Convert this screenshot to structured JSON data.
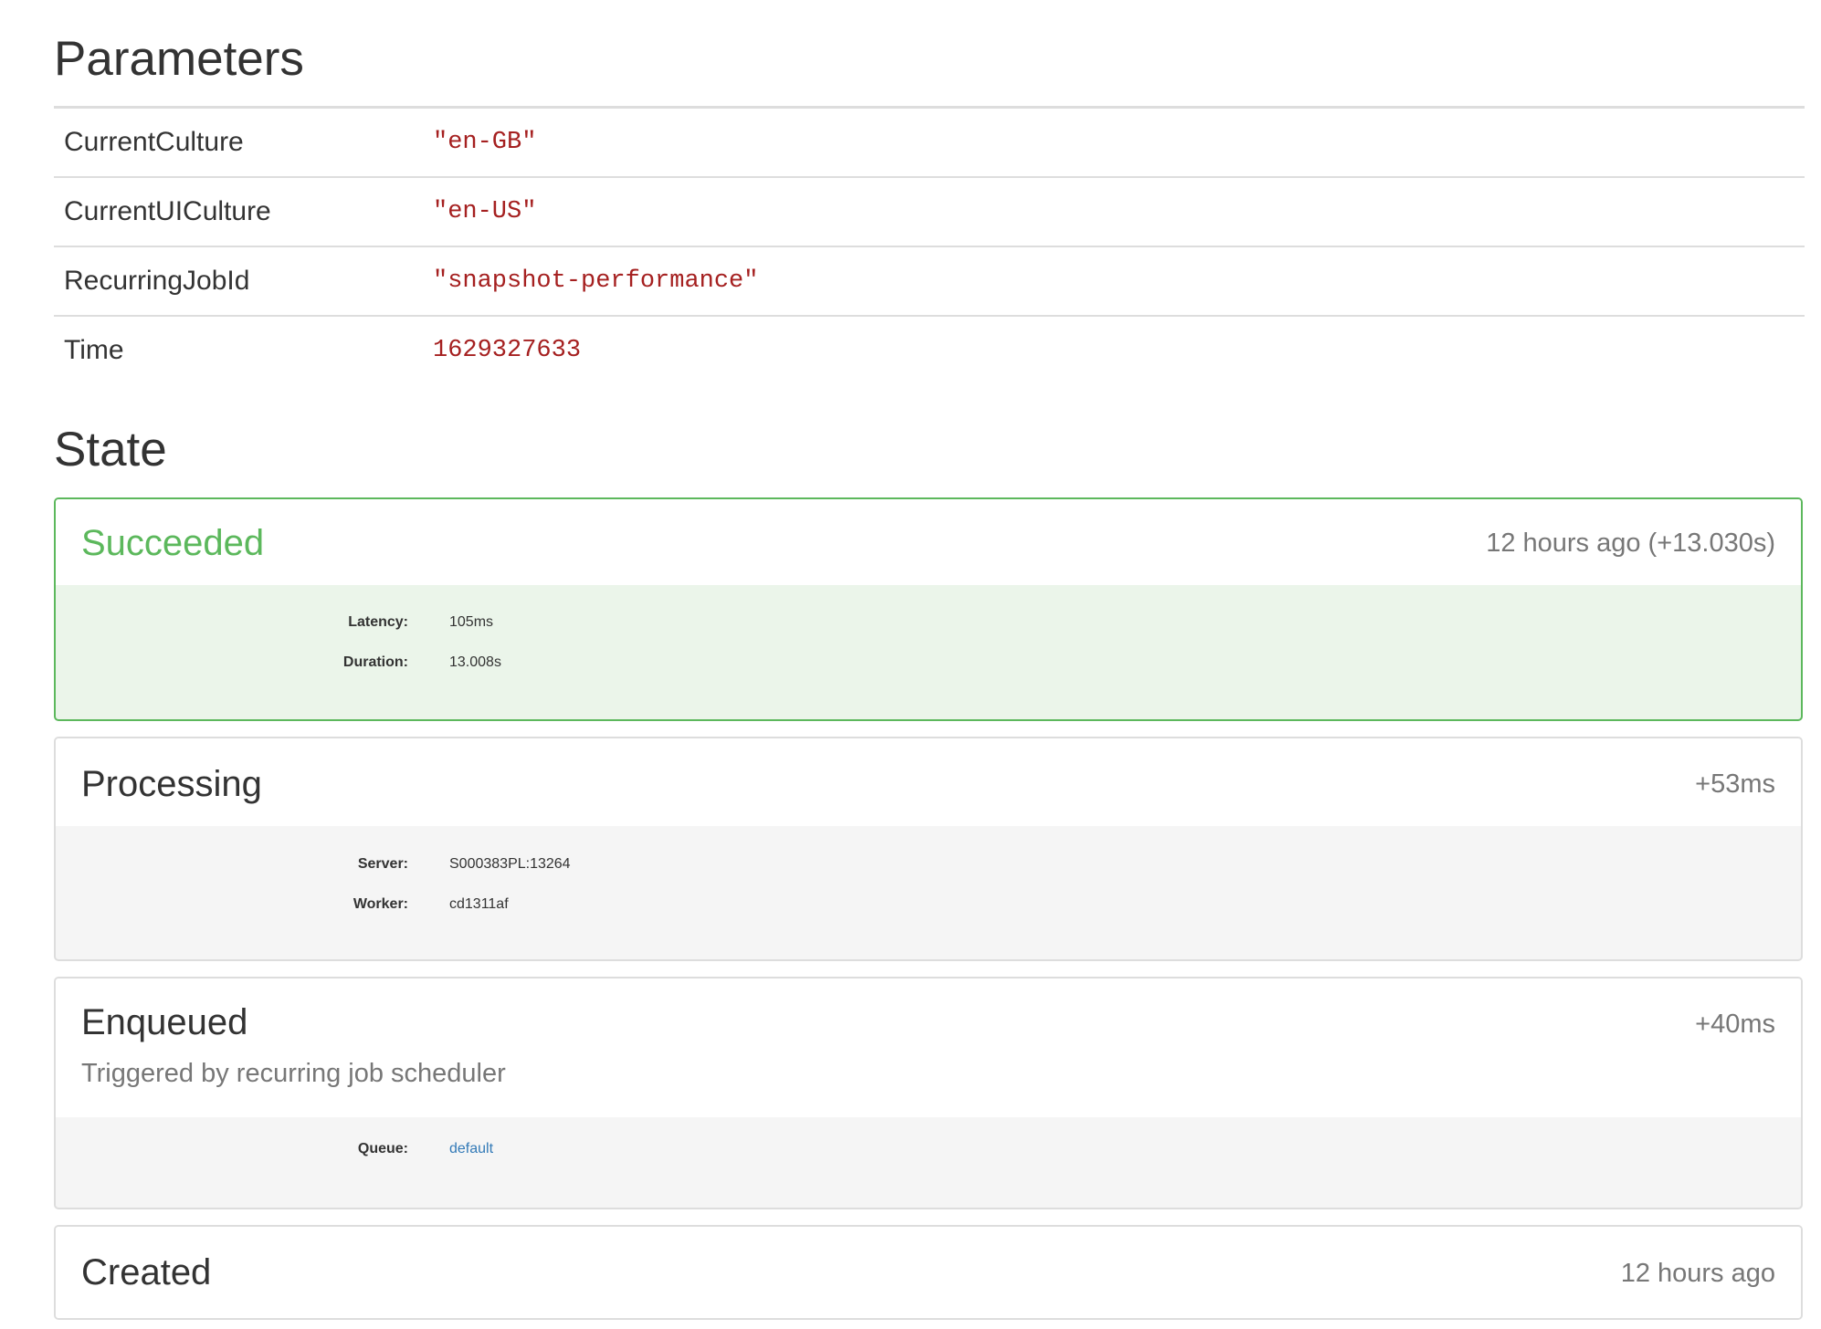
{
  "parameters": {
    "title": "Parameters",
    "rows": [
      {
        "name": "CurrentCulture",
        "value": "\"en-GB\""
      },
      {
        "name": "CurrentUICulture",
        "value": "\"en-US\""
      },
      {
        "name": "RecurringJobId",
        "value": "\"snapshot-performance\""
      },
      {
        "name": "Time",
        "value": "1629327633"
      }
    ]
  },
  "state": {
    "title": "State",
    "history": [
      {
        "name": "Succeeded",
        "time": "12 hours ago (+13.030s)",
        "details": [
          {
            "key": "Latency:",
            "value": "105ms"
          },
          {
            "key": "Duration:",
            "value": "13.008s"
          }
        ]
      },
      {
        "name": "Processing",
        "time": "+53ms",
        "details": [
          {
            "key": "Server:",
            "value": "S000383PL:13264"
          },
          {
            "key": "Worker:",
            "value": "cd1311af"
          }
        ]
      },
      {
        "name": "Enqueued",
        "time": "+40ms",
        "reason": "Triggered by recurring job scheduler",
        "details": [
          {
            "key": "Queue:",
            "value": "default"
          }
        ]
      },
      {
        "name": "Created",
        "time": "12 hours ago"
      }
    ]
  },
  "colors": {
    "succeeded_accent": "#5cb85c",
    "succeeded_bg": "#ebf5ea",
    "param_value": "#a52020",
    "link": "#337ab7"
  }
}
